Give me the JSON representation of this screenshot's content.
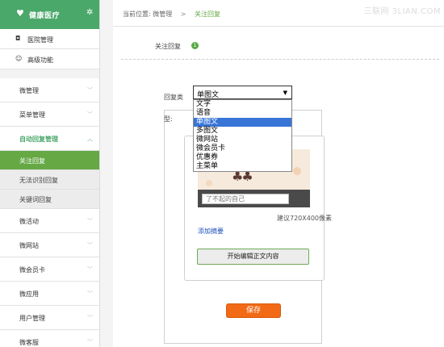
{
  "sidebar": {
    "brand": {
      "title": "健康医疗",
      "heart_icon": "heart-icon",
      "gear_icon": "gear-icon"
    },
    "top_items": [
      {
        "label": "医院管理",
        "icon": "camera-icon",
        "glyph": "◘"
      },
      {
        "label": "高级功能",
        "icon": "users-icon",
        "glyph": "☺"
      }
    ],
    "groups": [
      {
        "label": "微管理"
      },
      {
        "label": "菜单管理"
      },
      {
        "label": "自动回复管理",
        "open": true
      },
      {
        "label": "微活动"
      },
      {
        "label": "微网站"
      },
      {
        "label": "微会员卡"
      },
      {
        "label": "微应用"
      },
      {
        "label": "用户管理"
      },
      {
        "label": "微客服"
      }
    ],
    "sub_items": [
      {
        "label": "关注回复",
        "active": true
      },
      {
        "label": "无法识别回复"
      },
      {
        "label": "关键词回复"
      }
    ]
  },
  "breadcrumb": {
    "prefix": "当前位置:",
    "section": "微管理",
    "separator": ">",
    "current": "关注回复"
  },
  "watermark": "三联网 3LIAN.COM",
  "page": {
    "title": "关注回复",
    "badge": "1"
  },
  "form": {
    "reply_type_label": "回复类",
    "frag_label": "型:",
    "select_value": "单图文",
    "options": [
      "文字",
      "语音",
      "单图文",
      "多图文",
      "微网站",
      "微会员卡",
      "优惠券",
      "主菜单"
    ],
    "selected_index": 2
  },
  "editor": {
    "title_placeholder": "了不起的自己",
    "size_hint": "建议720X400像素",
    "add_summary": "添加摘要",
    "edit_button": "开始编辑正文内容"
  },
  "actions": {
    "save": "保存"
  },
  "colors": {
    "brand_green": "#4aa86a",
    "active_green": "#65a844",
    "save_orange": "#f26a16",
    "link_blue": "#1b4fb8",
    "select_blue": "#3875d7"
  }
}
